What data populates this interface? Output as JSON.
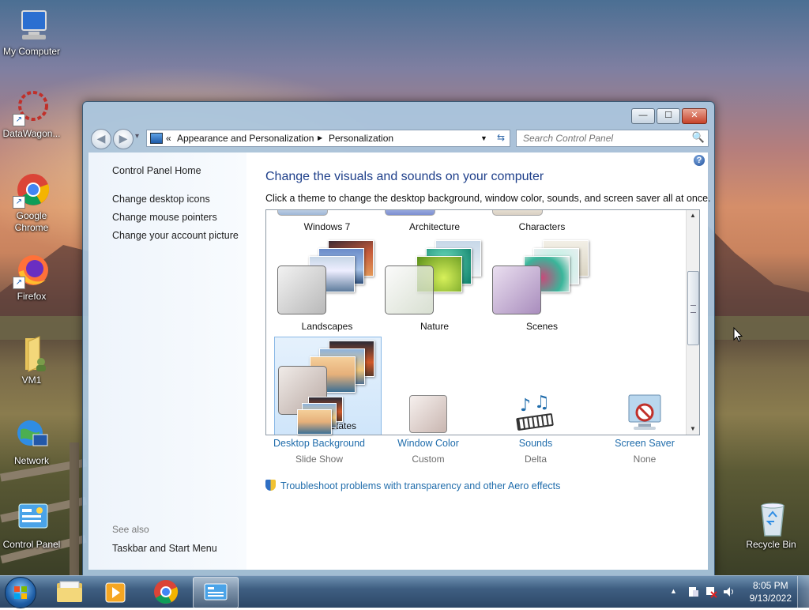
{
  "desktop": {
    "icons": [
      {
        "label": "My Computer",
        "icon": "computer-icon"
      },
      {
        "label": "DataWagon...",
        "icon": "datawagon-icon"
      },
      {
        "label": "Google Chrome",
        "icon": "chrome-icon"
      },
      {
        "label": "Firefox",
        "icon": "firefox-icon"
      },
      {
        "label": "VM1",
        "icon": "folder-user-icon"
      },
      {
        "label": "Network",
        "icon": "network-icon"
      },
      {
        "label": "Control Panel",
        "icon": "control-panel-icon"
      },
      {
        "label": "Recycle Bin",
        "icon": "recycle-bin-icon"
      }
    ]
  },
  "window": {
    "controls": {
      "minimize": "—",
      "maximize": "☐",
      "close": "✕"
    },
    "nav": {
      "back": "◀",
      "forward": "▶",
      "history": "▾"
    },
    "address": {
      "prefix": "«",
      "crumbs": [
        "Appearance and Personalization",
        "Personalization"
      ],
      "separator": "▶",
      "dropdown": "▼",
      "refresh": "⇆"
    },
    "search": {
      "placeholder": "Search Control Panel",
      "icon": "🔍"
    },
    "help": "?"
  },
  "left_pane": {
    "links": [
      "Control Panel Home",
      "Change desktop icons",
      "Change mouse pointers",
      "Change your account picture"
    ],
    "see_also_label": "See also",
    "see_also_links": [
      "Taskbar and Start Menu"
    ]
  },
  "main": {
    "title": "Change the visuals and sounds on your computer",
    "subtitle": "Click a theme to change the desktop background, window color, sounds, and screen saver all at once.",
    "themes_row_top": [
      "Windows 7",
      "Architecture",
      "Characters"
    ],
    "themes": [
      {
        "label": "Landscapes",
        "selected": false
      },
      {
        "label": "Nature",
        "selected": false
      },
      {
        "label": "Scenes",
        "selected": false
      },
      {
        "label": "United States",
        "selected": true
      }
    ],
    "scroll": {
      "up": "▲",
      "down": "▼"
    },
    "bottom_items": [
      {
        "label": "Desktop Background",
        "sub": "Slide Show",
        "icon": "desktop-background-icon"
      },
      {
        "label": "Window Color",
        "sub": "Custom",
        "icon": "window-color-icon"
      },
      {
        "label": "Sounds",
        "sub": "Delta",
        "icon": "sounds-icon"
      },
      {
        "label": "Screen Saver",
        "sub": "None",
        "icon": "screen-saver-icon"
      }
    ],
    "troubleshoot": "Troubleshoot problems with transparency and other Aero effects"
  },
  "taskbar": {
    "tray_arrow": "▲",
    "time": "8:05 PM",
    "date": "9/13/2022"
  }
}
